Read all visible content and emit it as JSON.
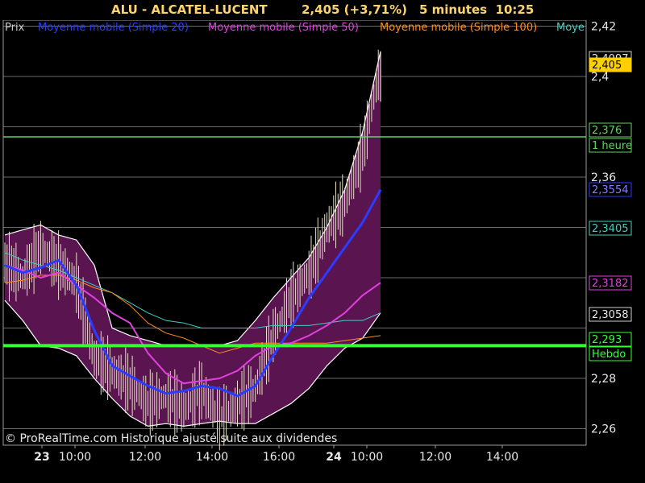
{
  "header": {
    "symbol": "ALU - ALCATEL-LUCENT",
    "price_change": "2,405 (+3,71%)",
    "period_time": "5 minutes  10:25"
  },
  "legend": {
    "items": [
      {
        "label": "Prix",
        "color": "#cfcfcf"
      },
      {
        "label": "Moyenne mobile (Simple 20)",
        "color": "#2a3cff"
      },
      {
        "label": "Moyenne mobile (Simple 50)",
        "color": "#e040e0"
      },
      {
        "label": "Moyenne mobile (Simple 100)",
        "color": "#ff8c1a"
      },
      {
        "label": "Moye",
        "color": "#40d0c0"
      }
    ]
  },
  "copyright": "© ProRealTime.com Historique ajusté suite aux dividendes",
  "colors": {
    "background": "#000000",
    "grid": "#6a6a6a",
    "band_fill": "#5a1450",
    "band_edge": "#ffffff",
    "sma20": "#2a3cff",
    "sma50": "#e040e0",
    "sma100": "#ff8c1a",
    "sma200": "#40d0c0",
    "candles": "#e8e0c8",
    "hour_line": "#5fd35f",
    "weekly_line": "#33ff33"
  },
  "chart_data": {
    "type": "line",
    "title": "ALU - ALCATEL-LUCENT",
    "ylim": [
      2.255,
      2.425
    ],
    "y_ticks": [
      "2,42",
      "2,4",
      "2,36",
      "2,28",
      "2,26"
    ],
    "x_ticks": [
      "23",
      "10:00",
      "12:00",
      "14:00",
      "16:00",
      "24",
      "10:00",
      "12:00",
      "14:00"
    ],
    "x_tick_bold": [
      true,
      false,
      false,
      false,
      false,
      true,
      false,
      false,
      false
    ],
    "session_x": [
      "23 09:00",
      "09:30",
      "10:00",
      "10:30",
      "11:00",
      "11:30",
      "12:00",
      "12:30",
      "13:00",
      "13:30",
      "14:00",
      "14:30",
      "15:00",
      "15:30",
      "16:00",
      "16:30",
      "17:00",
      "17:30",
      "24 09:00",
      "09:30",
      "10:00",
      "10:25"
    ],
    "sma20": [
      2.325,
      2.322,
      2.324,
      2.327,
      2.317,
      2.299,
      2.285,
      2.281,
      2.277,
      2.274,
      2.275,
      2.277,
      2.276,
      2.273,
      2.277,
      2.289,
      2.3,
      2.312,
      2.322,
      2.332,
      2.342,
      2.355
    ],
    "sma50": [
      2.325,
      2.323,
      2.32,
      2.322,
      2.317,
      2.312,
      2.306,
      2.302,
      2.29,
      2.282,
      2.278,
      2.279,
      2.28,
      2.283,
      2.289,
      2.293,
      2.294,
      2.297,
      2.301,
      2.306,
      2.313,
      2.318
    ],
    "sma100": [
      2.318,
      2.319,
      2.321,
      2.321,
      2.319,
      2.316,
      2.314,
      2.309,
      2.302,
      2.298,
      2.296,
      2.293,
      2.29,
      2.292,
      2.294,
      2.294,
      2.294,
      2.294,
      2.294,
      2.295,
      2.296,
      2.297
    ],
    "sma200": [
      2.33,
      2.327,
      2.325,
      2.323,
      2.32,
      2.317,
      2.314,
      2.31,
      2.306,
      2.303,
      2.302,
      2.3,
      2.3,
      2.3,
      2.3,
      2.301,
      2.301,
      2.301,
      2.302,
      2.303,
      2.303,
      2.306
    ],
    "band_upper": [
      2.337,
      2.339,
      2.341,
      2.337,
      2.335,
      2.325,
      2.3,
      2.297,
      2.295,
      2.293,
      2.293,
      2.293,
      2.293,
      2.295,
      2.303,
      2.312,
      2.32,
      2.328,
      2.34,
      2.355,
      2.378,
      2.41
    ],
    "band_lower": [
      2.311,
      2.303,
      2.293,
      2.292,
      2.289,
      2.28,
      2.272,
      2.265,
      2.261,
      2.262,
      2.261,
      2.262,
      2.263,
      2.262,
      2.262,
      2.266,
      2.27,
      2.276,
      2.285,
      2.292,
      2.296,
      2.306
    ],
    "price": [
      2.326,
      2.32,
      2.332,
      2.325,
      2.318,
      2.288,
      2.283,
      2.278,
      2.27,
      2.273,
      2.268,
      2.275,
      2.264,
      2.27,
      2.276,
      2.297,
      2.312,
      2.322,
      2.34,
      2.35,
      2.37,
      2.405
    ],
    "price_tags": [
      {
        "label": "2,4097",
        "value": 2.4097,
        "bg": "#000000",
        "fg": "#e8e8e8",
        "border": "#cfcfcf"
      },
      {
        "label": "2,405",
        "value": 2.405,
        "bg": "#ffd000",
        "fg": "#000000",
        "border": "#ffd000"
      },
      {
        "label": "2,376",
        "value": 2.376,
        "bg": "#000000",
        "fg": "#5fd35f",
        "border": "#5fd35f"
      },
      {
        "label": "1 heure",
        "value": 2.376,
        "bg": "#000000",
        "fg": "#5fd35f",
        "border": "#5fd35f"
      },
      {
        "label": "2,3554",
        "value": 2.3554,
        "bg": "#000000",
        "fg": "#8a7cff",
        "border": "#2a3cff"
      },
      {
        "label": "2,3405",
        "value": 2.3405,
        "bg": "#000000",
        "fg": "#40d0c0",
        "border": "#40d0c0"
      },
      {
        "label": "2,3182",
        "value": 2.3182,
        "bg": "#000000",
        "fg": "#e040e0",
        "border": "#e040e0"
      },
      {
        "label": "2,3058",
        "value": 2.3058,
        "bg": "#000000",
        "fg": "#e8e8e8",
        "border": "#cfcfcf"
      },
      {
        "label": "2,293",
        "value": 2.293,
        "bg": "#000000",
        "fg": "#33ff33",
        "border": "#33ff33"
      },
      {
        "label": "Hebdo",
        "value": 2.293,
        "bg": "#000000",
        "fg": "#33ff33",
        "border": "#33ff33"
      }
    ],
    "hour_level": 2.376,
    "weekly_level": 2.293
  }
}
